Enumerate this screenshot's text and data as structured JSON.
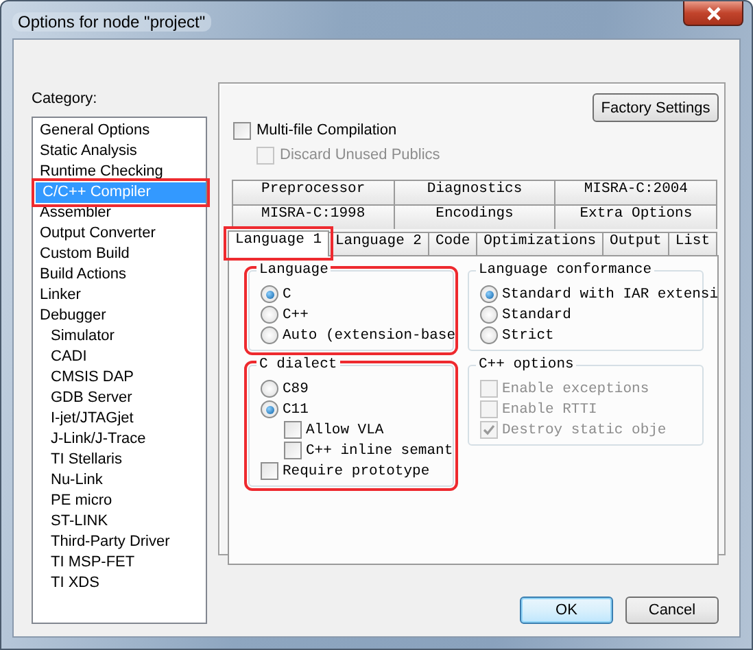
{
  "window": {
    "title": "Options for node \"project\""
  },
  "category": {
    "label": "Category:",
    "items": [
      {
        "label": "General Options",
        "selected": false,
        "highlighted": false
      },
      {
        "label": "Static Analysis",
        "selected": false,
        "highlighted": false
      },
      {
        "label": "Runtime Checking",
        "selected": false,
        "highlighted": false
      },
      {
        "label": "C/C++ Compiler",
        "selected": true,
        "highlighted": true
      },
      {
        "label": "Assembler",
        "selected": false,
        "highlighted": false
      },
      {
        "label": "Output Converter",
        "selected": false,
        "highlighted": false
      },
      {
        "label": "Custom Build",
        "selected": false,
        "highlighted": false
      },
      {
        "label": "Build Actions",
        "selected": false,
        "highlighted": false
      },
      {
        "label": "Linker",
        "selected": false,
        "highlighted": false
      },
      {
        "label": "Debugger",
        "selected": false,
        "highlighted": false,
        "children": [
          {
            "label": "Simulator",
            "selected": false,
            "highlighted": false
          },
          {
            "label": "CADI",
            "selected": false,
            "highlighted": false
          },
          {
            "label": "CMSIS DAP",
            "selected": false,
            "highlighted": false
          },
          {
            "label": "GDB Server",
            "selected": false,
            "highlighted": false
          },
          {
            "label": "I-jet/JTAGjet",
            "selected": false,
            "highlighted": false
          },
          {
            "label": "J-Link/J-Trace",
            "selected": false,
            "highlighted": false
          },
          {
            "label": "TI Stellaris",
            "selected": false,
            "highlighted": false
          },
          {
            "label": "Nu-Link",
            "selected": false,
            "highlighted": false
          },
          {
            "label": "PE micro",
            "selected": false,
            "highlighted": false
          },
          {
            "label": "ST-LINK",
            "selected": false,
            "highlighted": false
          },
          {
            "label": "Third-Party Driver",
            "selected": false,
            "highlighted": false
          },
          {
            "label": "TI MSP-FET",
            "selected": false,
            "highlighted": false
          },
          {
            "label": "TI XDS",
            "selected": false,
            "highlighted": false
          }
        ]
      }
    ]
  },
  "factory_settings_button": "Factory Settings",
  "options": [
    {
      "label": "Multi-file Compilation",
      "checked": false,
      "disabled": false,
      "children": [
        {
          "label": "Discard Unused Publics",
          "checked": false,
          "disabled": true
        }
      ]
    }
  ],
  "tab_rows": [
    [
      {
        "label": "Preprocessor",
        "selected": false,
        "highlighted": false
      },
      {
        "label": "Diagnostics",
        "selected": false,
        "highlighted": false
      },
      {
        "label": "MISRA-C:2004",
        "selected": false,
        "highlighted": false
      }
    ],
    [
      {
        "label": "MISRA-C:1998",
        "selected": false,
        "highlighted": false
      },
      {
        "label": "Encodings",
        "selected": false,
        "highlighted": false
      },
      {
        "label": "Extra Options",
        "selected": false,
        "highlighted": false
      }
    ],
    [
      {
        "label": "Language 1",
        "selected": true,
        "highlighted": true
      },
      {
        "label": "Language 2",
        "selected": false,
        "highlighted": false
      },
      {
        "label": "Code",
        "selected": false,
        "highlighted": false
      },
      {
        "label": "Optimizations",
        "selected": false,
        "highlighted": false
      },
      {
        "label": "Output",
        "selected": false,
        "highlighted": false
      },
      {
        "label": "List",
        "selected": false,
        "highlighted": false
      }
    ]
  ],
  "groups": [
    {
      "title": "Language",
      "highlighted": true,
      "items": [
        {
          "kind": "radio",
          "label": "C",
          "selected": true
        },
        {
          "kind": "radio",
          "label": "C++",
          "selected": false
        },
        {
          "kind": "radio",
          "label": "Auto (extension-base",
          "selected": false
        }
      ]
    },
    {
      "title": "Language conformance",
      "highlighted": false,
      "items": [
        {
          "kind": "radio",
          "label": "Standard with IAR extensi",
          "selected": true
        },
        {
          "kind": "radio",
          "label": "Standard",
          "selected": false
        },
        {
          "kind": "radio",
          "label": "Strict",
          "selected": false
        }
      ]
    },
    {
      "title": "C dialect",
      "highlighted": true,
      "items": [
        {
          "kind": "radio",
          "label": "C89",
          "selected": false
        },
        {
          "kind": "radio",
          "label": "C11",
          "selected": true,
          "children": [
            {
              "kind": "checkbox",
              "label": "Allow VLA",
              "checked": false,
              "disabled": false
            },
            {
              "kind": "checkbox",
              "label": "C++ inline semant",
              "checked": false,
              "disabled": false
            }
          ]
        },
        {
          "kind": "checkbox",
          "label": "Require prototype",
          "checked": false,
          "disabled": false
        }
      ]
    },
    {
      "title": "C++ options",
      "highlighted": false,
      "items": [
        {
          "kind": "checkbox",
          "label": "Enable exceptions",
          "checked": false,
          "disabled": true
        },
        {
          "kind": "checkbox",
          "label": "Enable RTTI",
          "checked": false,
          "disabled": true
        },
        {
          "kind": "checkbox",
          "label": "Destroy static obje",
          "checked": true,
          "disabled": true
        }
      ]
    }
  ],
  "buttons": [
    {
      "label": "OK",
      "default": true
    },
    {
      "label": "Cancel",
      "default": false
    }
  ]
}
